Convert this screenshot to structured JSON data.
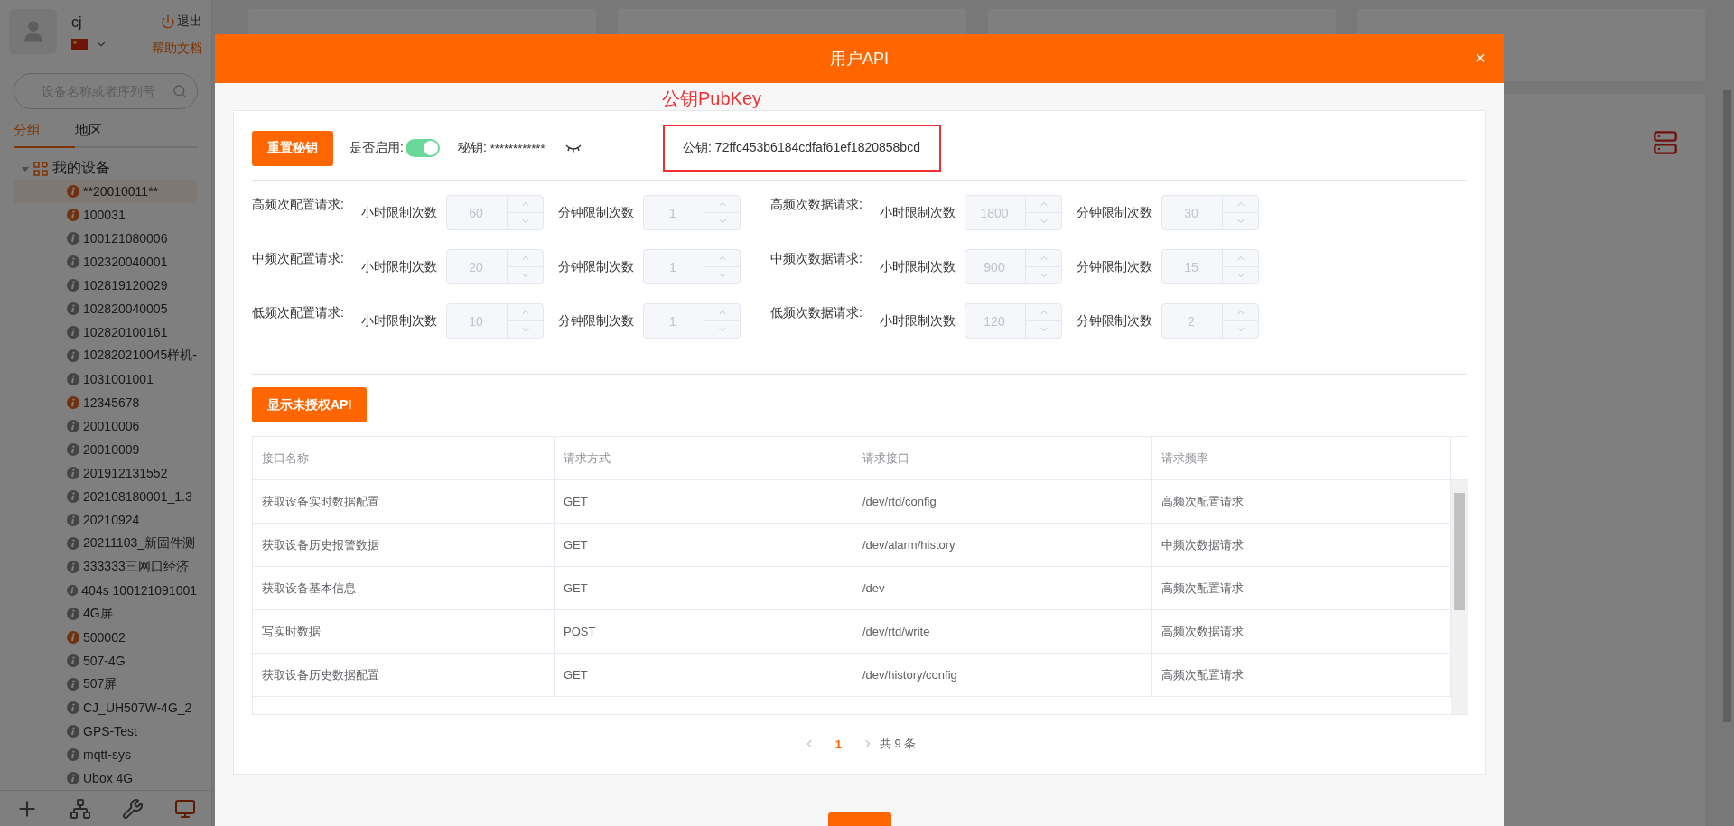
{
  "app": {
    "user": {
      "name": "cj",
      "logout": "退出",
      "help": "帮助文档"
    },
    "search": {
      "placeholder": "设备名称或者序列号"
    },
    "tabs": [
      {
        "label": "分组",
        "selected": true
      },
      {
        "label": "地区",
        "selected": false
      }
    ],
    "tree": {
      "label": "我的设备",
      "expanded": true,
      "children": [
        {
          "label": "**20010011**",
          "alert": true,
          "selected": true
        },
        {
          "label": "100031",
          "alert": true,
          "selected": false
        },
        {
          "label": "100121080006",
          "alert": false,
          "selected": false
        },
        {
          "label": "102320040001",
          "alert": false,
          "selected": false
        },
        {
          "label": "102819120029",
          "alert": false,
          "selected": false
        },
        {
          "label": "102820040005",
          "alert": false,
          "selected": false
        },
        {
          "label": "102820100161",
          "alert": false,
          "selected": false
        },
        {
          "label": "102820210045样机-",
          "alert": false,
          "selected": false
        },
        {
          "label": "1031001001",
          "alert": false,
          "selected": false
        },
        {
          "label": "12345678",
          "alert": true,
          "selected": false
        },
        {
          "label": "20010006",
          "alert": false,
          "selected": false
        },
        {
          "label": "20010009",
          "alert": false,
          "selected": false
        },
        {
          "label": "201912131552",
          "alert": false,
          "selected": false
        },
        {
          "label": "202108180001_1.3",
          "alert": false,
          "selected": false
        },
        {
          "label": "20210924",
          "alert": false,
          "selected": false
        },
        {
          "label": "20211103_新固件测",
          "alert": false,
          "selected": false
        },
        {
          "label": "333333三网口经济",
          "alert": false,
          "selected": false
        },
        {
          "label": "404s 100121091001",
          "alert": false,
          "selected": false
        },
        {
          "label": "4G屏",
          "alert": false,
          "selected": false
        },
        {
          "label": "500002",
          "alert": true,
          "selected": false
        },
        {
          "label": "507-4G",
          "alert": false,
          "selected": false
        },
        {
          "label": "507屏",
          "alert": false,
          "selected": false
        },
        {
          "label": "CJ_UH507W-4G_2",
          "alert": false,
          "selected": false
        },
        {
          "label": "GPS-Test",
          "alert": false,
          "selected": false
        },
        {
          "label": "mqtt-sys",
          "alert": false,
          "selected": false
        },
        {
          "label": "Ubox 4G",
          "alert": false,
          "selected": false
        }
      ]
    },
    "toolbar": [
      {
        "kind": "add",
        "selected": false
      },
      {
        "kind": "network",
        "selected": false
      },
      {
        "kind": "tools",
        "selected": false
      },
      {
        "kind": "monitor",
        "selected": true
      }
    ]
  },
  "dialog": {
    "title": "用户API",
    "close": "×",
    "annotation": {
      "label": "公钥PubKey"
    },
    "reset_button": "重置秘钥",
    "enabled": {
      "label": "是否启用:",
      "on": true
    },
    "secret": {
      "label": "秘钥:",
      "value": "************",
      "visible": false
    },
    "public_key": "公钥: 72ffc453b6184cdfaf61ef1820858bcd",
    "limits": [
      {
        "label": "高频次配置请求:",
        "hour_label": "小时限制次数",
        "hour": "60",
        "minute_label": "分钟限制次数",
        "minute": "1",
        "disabled": true
      },
      {
        "label": "高频次数据请求:",
        "hour_label": "小时限制次数",
        "hour": "1800",
        "minute_label": "分钟限制次数",
        "minute": "30",
        "disabled": true
      },
      {
        "label": "中频次配置请求:",
        "hour_label": "小时限制次数",
        "hour": "20",
        "minute_label": "分钟限制次数",
        "minute": "1",
        "disabled": true
      },
      {
        "label": "中频次数据请求:",
        "hour_label": "小时限制次数",
        "hour": "900",
        "minute_label": "分钟限制次数",
        "minute": "15",
        "disabled": true
      },
      {
        "label": "低频次配置请求:",
        "hour_label": "小时限制次数",
        "hour": "10",
        "minute_label": "分钟限制次数",
        "minute": "1",
        "disabled": true
      },
      {
        "label": "低频次数据请求:",
        "hour_label": "小时限制次数",
        "hour": "120",
        "minute_label": "分钟限制次数",
        "minute": "2",
        "disabled": true
      }
    ],
    "show_button": "显示未授权API",
    "table": {
      "columns": [
        "接口名称",
        "请求方式",
        "请求接口",
        "请求频率"
      ],
      "rows": [
        [
          "获取设备实时数据配置",
          "GET",
          "/dev/rtd/config",
          "高频次配置请求"
        ],
        [
          "获取设备历史报警数据",
          "GET",
          "/dev/alarm/history",
          "中频次数据请求"
        ],
        [
          "获取设备基本信息",
          "GET",
          "/dev",
          "高频次配置请求"
        ],
        [
          "写实时数据",
          "POST",
          "/dev/rtd/write",
          "高频次数据请求"
        ],
        [
          "获取设备历史数据配置",
          "GET",
          "/dev/history/config",
          "高频次配置请求"
        ]
      ]
    },
    "pagination": {
      "pages": [
        {
          "label": "1",
          "selected": true
        }
      ],
      "total": "共 9 条"
    }
  }
}
